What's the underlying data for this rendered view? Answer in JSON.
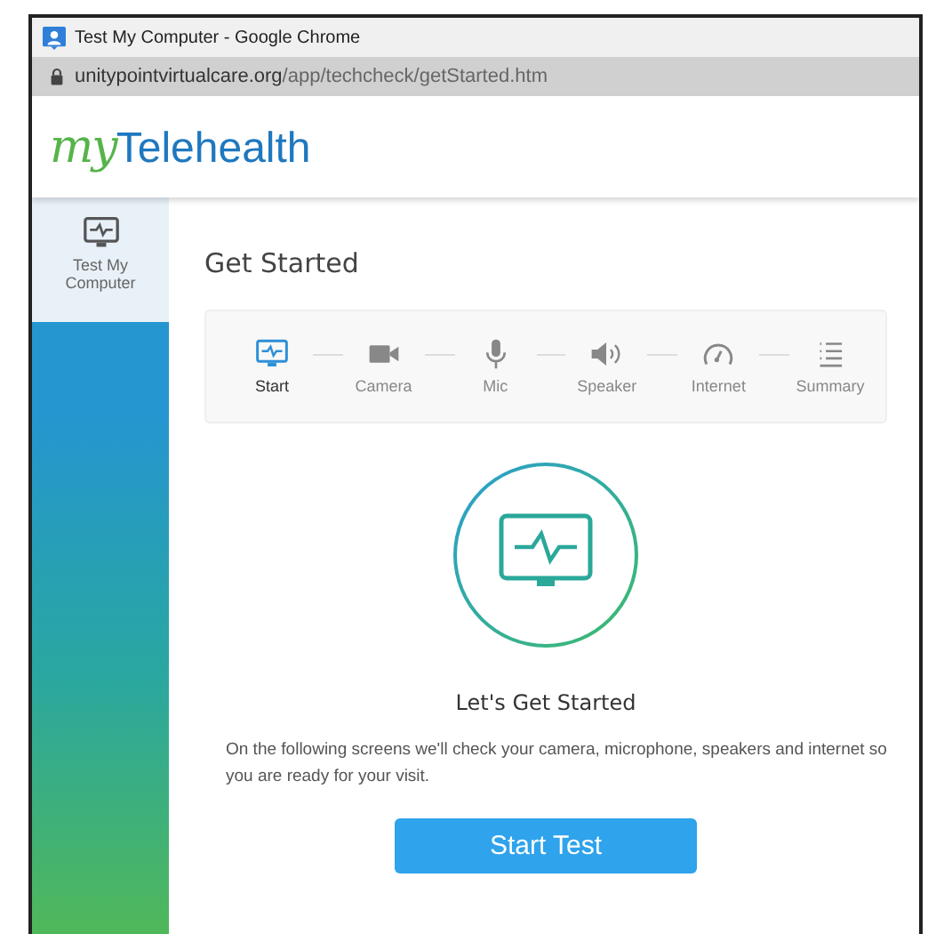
{
  "window": {
    "title": "Test My Computer - Google Chrome"
  },
  "address_bar": {
    "domain": "unitypointvirtualcare.org",
    "path": "/app/techcheck/getStarted.htm"
  },
  "logo": {
    "prefix": "my",
    "name": "Telehealth"
  },
  "sidebar": {
    "items": [
      {
        "label": "Test My Computer",
        "selected": true
      }
    ]
  },
  "page_title": "Get Started",
  "steps": [
    {
      "kind": "start",
      "label": "Start",
      "selected": true
    },
    {
      "kind": "camera",
      "label": "Camera",
      "selected": false
    },
    {
      "kind": "mic",
      "label": "Mic",
      "selected": false
    },
    {
      "kind": "speaker",
      "label": "Speaker",
      "selected": false
    },
    {
      "kind": "internet",
      "label": "Internet",
      "selected": false
    },
    {
      "kind": "summary",
      "label": "Summary",
      "selected": false
    }
  ],
  "intro": {
    "heading": "Let's Get Started",
    "text": "On the following screens we'll check your camera, microphone, speakers and internet so you are ready for your visit.",
    "button": "Start Test"
  }
}
